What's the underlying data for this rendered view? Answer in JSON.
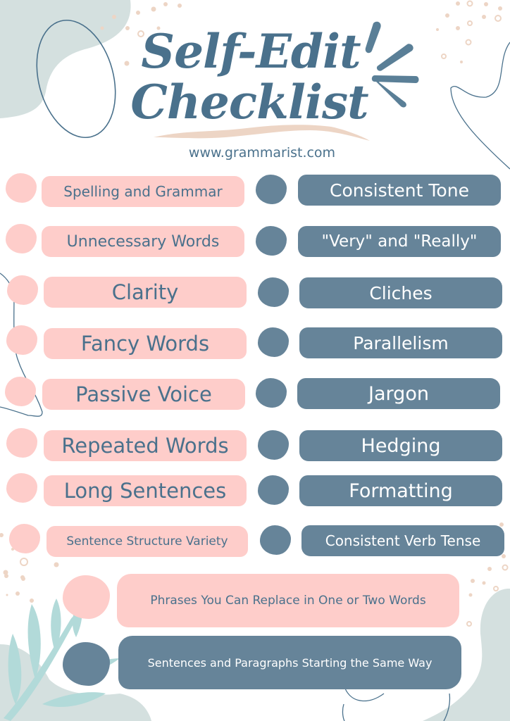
{
  "header": {
    "title_line1": "Self-Edit",
    "title_line2": "Checklist",
    "website": "www.grammarist.com"
  },
  "colors": {
    "pink": "#fecdca",
    "slate_blue": "#668499",
    "title_blue": "#4a718c",
    "sage": "#d4e0df",
    "leaf": "#b2dad9",
    "speckle": "#edd5c5"
  },
  "checklist": {
    "left": [
      {
        "label": "Spelling and Grammar",
        "checked": false
      },
      {
        "label": "Unnecessary Words",
        "checked": false
      },
      {
        "label": "Clarity",
        "checked": false
      },
      {
        "label": "Fancy Words",
        "checked": false
      },
      {
        "label": "Passive Voice",
        "checked": false
      },
      {
        "label": "Repeated Words",
        "checked": false
      },
      {
        "label": "Long Sentences",
        "checked": false
      },
      {
        "label": "Sentence Structure Variety",
        "checked": false
      }
    ],
    "right": [
      {
        "label": "Consistent Tone",
        "checked": false
      },
      {
        "label": "\"Very\" and \"Really\"",
        "checked": false
      },
      {
        "label": "Cliches",
        "checked": false
      },
      {
        "label": "Parallelism",
        "checked": false
      },
      {
        "label": "Jargon",
        "checked": false
      },
      {
        "label": "Hedging",
        "checked": false
      },
      {
        "label": "Formatting",
        "checked": false
      },
      {
        "label": "Consistent Verb Tense",
        "checked": false
      }
    ],
    "wide": [
      {
        "label": "Phrases You Can Replace in One or Two Words",
        "checked": false
      },
      {
        "label": "Sentences and Paragraphs Starting the Same Way",
        "checked": false
      }
    ]
  },
  "decorations": {
    "top_left": "sage-blob-with-oval-outline",
    "top_right": "speckles-and-wavy-line",
    "burst": "sunburst-strokes-icon",
    "underline": "brush-swash",
    "bottom_left": "leaf-branch-on-sage-blob",
    "bottom_right": "sage-blob-with-speckles"
  }
}
